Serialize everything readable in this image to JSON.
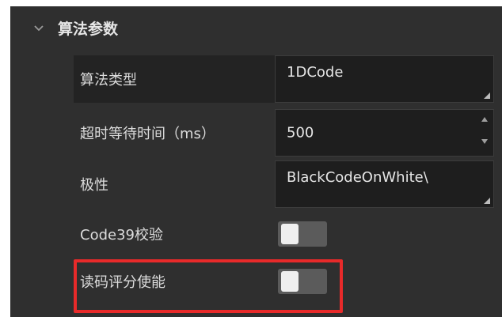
{
  "section": {
    "title": "算法参数",
    "expand_icon": "chevron-down-icon"
  },
  "params": {
    "algorithm_type": {
      "label": "算法类型",
      "value": "1DCode"
    },
    "timeout": {
      "label": "超时等待时间（ms）",
      "value": "500"
    },
    "polarity": {
      "label": "极性",
      "value": "BlackCodeOnWhite\\"
    },
    "code39_check": {
      "label": "Code39校验",
      "state": "off"
    },
    "read_score_enable": {
      "label": "读码评分使能",
      "state": "off"
    }
  },
  "colors": {
    "panel_bg": "#2f2f2f",
    "field_bg": "#1e1e1e",
    "highlight": "#e82a2a",
    "toggle_track": "#5b5b5b"
  }
}
